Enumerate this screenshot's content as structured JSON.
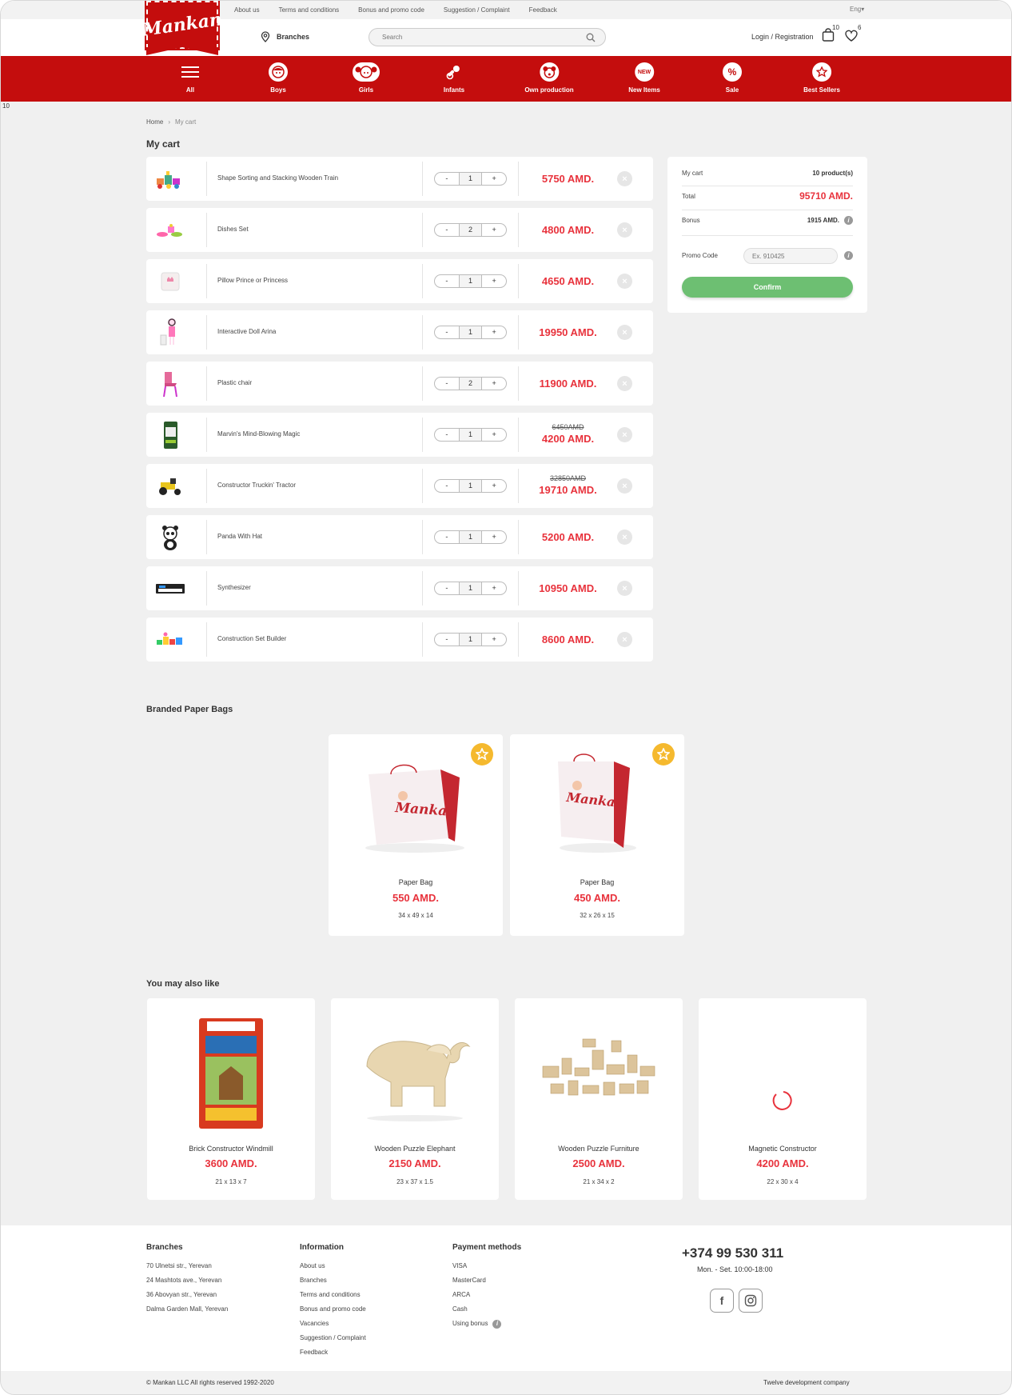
{
  "header": {
    "logo_text": "Mankan",
    "top_links": [
      "About us",
      "Terms and conditions",
      "Bonus and promo code",
      "Suggestion / Complaint",
      "Feedback"
    ],
    "language": "Eng",
    "branches_label": "Branches",
    "search_placeholder": "Search",
    "login_label": "Login / Registration",
    "cart_count": "10",
    "wishlist_count": "6"
  },
  "nav": {
    "items": [
      {
        "label": "All",
        "icon": "menu-icon"
      },
      {
        "label": "Boys",
        "icon": "boy-face-icon"
      },
      {
        "label": "Girls",
        "icon": "girl-face-icon"
      },
      {
        "label": "Infants",
        "icon": "pacifier-icon"
      },
      {
        "label": "Own production",
        "icon": "bear-icon"
      },
      {
        "label": "New Items",
        "icon": "new-badge-icon",
        "badge": "NEW"
      },
      {
        "label": "Sale",
        "icon": "percent-icon",
        "badge": "%"
      },
      {
        "label": "Best Sellers",
        "icon": "star-icon"
      }
    ],
    "stray_number": "10"
  },
  "breadcrumb": {
    "home": "Home",
    "current": "My cart"
  },
  "page_title": "My cart",
  "cart": {
    "items": [
      {
        "name": "Shape Sorting and Stacking Wooden Train",
        "qty": "1",
        "price": "5750 AMD.",
        "old_price": ""
      },
      {
        "name": "Dishes Set",
        "qty": "2",
        "price": "4800 AMD.",
        "old_price": ""
      },
      {
        "name": "Pillow Prince or Princess",
        "qty": "1",
        "price": "4650 AMD.",
        "old_price": ""
      },
      {
        "name": "Interactive Doll Arina",
        "qty": "1",
        "price": "19950 AMD.",
        "old_price": ""
      },
      {
        "name": "Plastic chair",
        "qty": "2",
        "price": "11900 AMD.",
        "old_price": ""
      },
      {
        "name": "Marvin's Mind-Blowing Magic",
        "qty": "1",
        "price": "4200 AMD.",
        "old_price": "6450AMD"
      },
      {
        "name": "Constructor Truckin' Tractor",
        "qty": "1",
        "price": "19710 AMD.",
        "old_price": "32850AMD"
      },
      {
        "name": "Panda With Hat",
        "qty": "1",
        "price": "5200 AMD.",
        "old_price": ""
      },
      {
        "name": "Synthesizer",
        "qty": "1",
        "price": "10950 AMD.",
        "old_price": ""
      },
      {
        "name": "Construction Set Builder",
        "qty": "1",
        "price": "8600 AMD.",
        "old_price": ""
      }
    ],
    "minus": "-",
    "plus": "+",
    "remove": "×"
  },
  "summary": {
    "cart_label": "My cart",
    "cart_value": "10 product(s)",
    "total_label": "Total",
    "total_value": "95710 AMD.",
    "bonus_label": "Bonus",
    "bonus_value": "1915 AMD.",
    "promo_label": "Promo Code",
    "promo_placeholder": "Ex. 910425",
    "confirm_label": "Confirm",
    "info_glyph": "i"
  },
  "paper_bags": {
    "title": "Branded Paper Bags",
    "items": [
      {
        "name": "Paper Bag",
        "price": "550 AMD.",
        "size": "34 x 49 x 14"
      },
      {
        "name": "Paper Bag",
        "price": "450 AMD.",
        "size": "32 x 26 x 15"
      }
    ]
  },
  "suggestions": {
    "title": "You may also like",
    "items": [
      {
        "name": "Brick Constructor Windmill",
        "price": "3600 AMD.",
        "size": "21 x 13 x 7"
      },
      {
        "name": "Wooden Puzzle Elephant",
        "price": "2150 AMD.",
        "size": "23 x 37 x 1.5"
      },
      {
        "name": "Wooden Puzzle Furniture",
        "price": "2500 AMD.",
        "size": "21 x 34 x 2"
      },
      {
        "name": "Magnetic Constructor",
        "price": "4200 AMD.",
        "size": "22 x 30 x 4"
      }
    ]
  },
  "footer": {
    "branches": {
      "title": "Branches",
      "items": [
        "70 Ulnetsi str., Yerevan",
        "24 Mashtots ave., Yerevan",
        "36 Abovyan str., Yerevan",
        "Dalma Garden Mall, Yerevan"
      ]
    },
    "information": {
      "title": "Information",
      "items": [
        "About us",
        "Branches",
        "Terms and conditions",
        "Bonus and promo code",
        "Vacancies",
        "Suggestion / Complaint",
        "Feedback"
      ]
    },
    "payment": {
      "title": "Payment methods",
      "items": [
        "VISA",
        "MasterCard",
        "ARCA",
        "Cash",
        "Using bonus"
      ]
    },
    "phone": "+374 99 530 311",
    "hours": "Mon. - Set. 10:00-18:00",
    "social": {
      "facebook": "f",
      "instagram": "instagram-icon"
    },
    "copyright": "© Mankan LLC All rights reserved 1992-2020",
    "developer": "Twelve development company"
  },
  "colors": {
    "brand_red": "#c40d0d",
    "price_red": "#e8323c",
    "confirm_green": "#6dbf72",
    "favorite_yellow": "#f5b92e"
  }
}
